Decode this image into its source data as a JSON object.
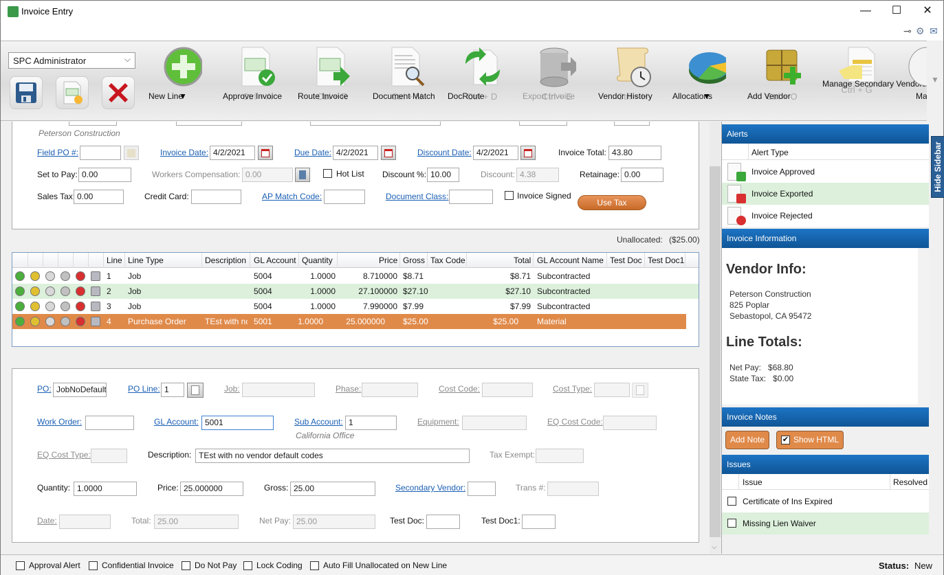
{
  "window": {
    "title": "Invoice Entry",
    "minimize": "—",
    "maximize": "☐",
    "close": "✕"
  },
  "ribbon": {
    "user_select": "SPC Administrator",
    "buttons": [
      {
        "label": "New Line",
        "shortcut": "",
        "dropdown": "▼",
        "icon": "plus-circle-icon",
        "enabled": true
      },
      {
        "label": "Approve Invoice",
        "shortcut": "Ctrl + A",
        "icon": "approve-invoice-icon",
        "enabled": true
      },
      {
        "label": "Route Invoice",
        "shortcut": "Ctrl + R",
        "icon": "route-invoice-icon",
        "enabled": true
      },
      {
        "label": "Document Match",
        "shortcut": "Ctrl + M",
        "icon": "document-match-icon",
        "enabled": true
      },
      {
        "label": "DocRoute",
        "shortcut": "Ctrl + D",
        "icon": "docroute-icon",
        "enabled": true
      },
      {
        "label": "Export Invoice",
        "shortcut": "Ctrl + E",
        "icon": "export-database-icon",
        "enabled": false
      },
      {
        "label": "Vendor History",
        "shortcut": "Ctrl + H",
        "icon": "vendor-history-icon",
        "enabled": true
      },
      {
        "label": "Allocations",
        "shortcut": "",
        "dropdown": "▼",
        "icon": "pie-chart-icon",
        "enabled": true
      },
      {
        "label": "Add Vendor",
        "shortcut": "Ctrl + O",
        "icon": "add-vendor-icon",
        "enabled": true
      },
      {
        "label": "Manage Secondary Vendors",
        "shortcut": "Ctrl + G",
        "icon": "secondary-vendors-icon",
        "enabled": true
      },
      {
        "label": "Match",
        "shortcut": "",
        "icon": "match-icon",
        "enabled": true
      }
    ]
  },
  "header_form": {
    "vendor_name": "Peterson Construction",
    "field_po_label": "Field PO #:",
    "field_po": "",
    "invoice_date_label": "Invoice Date:",
    "invoice_date": "4/2/2021",
    "due_date_label": "Due Date:",
    "due_date": "4/2/2021",
    "discount_date_label": "Discount Date:",
    "discount_date": "4/2/2021",
    "invoice_total_label": "Invoice Total:",
    "invoice_total": "43.80",
    "set_to_pay_label": "Set to Pay:",
    "set_to_pay": "0.00",
    "workers_comp_label": "Workers Compensation:",
    "workers_comp": "0.00",
    "hot_list_label": "Hot List",
    "discount_pct_label": "Discount %:",
    "discount_pct": "10.00",
    "discount_label": "Discount:",
    "discount": "4.38",
    "retainage_label": "Retainage:",
    "retainage": "0.00",
    "sales_tax_label": "Sales Tax:",
    "sales_tax": "0.00",
    "credit_card_label": "Credit Card:",
    "credit_card": "",
    "ap_match_label": "AP Match Code:",
    "ap_match": "",
    "doc_class_label": "Document Class:",
    "doc_class": "",
    "invoice_signed_label": "Invoice Signed",
    "use_tax_label": "Use Tax"
  },
  "unallocated": {
    "label": "Unallocated:",
    "value": "($25.00)"
  },
  "lines_grid": {
    "columns": [
      "Line",
      "Line Type",
      "Description",
      "GL Account",
      "Quantity",
      "Price",
      "Gross",
      "Tax Code",
      "Total",
      "GL Account Name",
      "Test Doc",
      "Test Doc1"
    ],
    "rows": [
      {
        "line": "1",
        "type": "Job",
        "desc": "",
        "gl": "5004",
        "qty": "1.0000",
        "price": "8.710000",
        "gross": "$8.71",
        "tax": "",
        "total": "$8.71",
        "glname": "Subcontracted"
      },
      {
        "line": "2",
        "type": "Job",
        "desc": "",
        "gl": "5004",
        "qty": "1.0000",
        "price": "27.100000",
        "gross": "$27.10",
        "tax": "",
        "total": "$27.10",
        "glname": "Subcontracted"
      },
      {
        "line": "3",
        "type": "Job",
        "desc": "",
        "gl": "5004",
        "qty": "1.0000",
        "price": "7.990000",
        "gross": "$7.99",
        "tax": "",
        "total": "$7.99",
        "glname": "Subcontracted"
      },
      {
        "line": "4",
        "type": "Purchase Order",
        "desc": "TEst with nc",
        "gl": "5001",
        "qty": "1.0000",
        "price": "25.000000",
        "gross": "$25.00",
        "tax": "",
        "total": "$25.00",
        "glname": "Material"
      }
    ]
  },
  "line_form": {
    "po_label": "PO:",
    "po": "JobNoDefault",
    "po_line_label": "PO Line:",
    "po_line": "1",
    "job_label": "Job:",
    "phase_label": "Phase:",
    "cost_code_label": "Cost Code:",
    "cost_type_label": "Cost Type:",
    "work_order_label": "Work Order:",
    "work_order": "",
    "gl_account_label": "GL Account:",
    "gl_account": "5001",
    "sub_account_label": "Sub Account:",
    "sub_account": "1",
    "sub_account_name": "California Office",
    "equipment_label": "Equipment:",
    "eq_cost_code_label": "EQ Cost Code:",
    "eq_cost_type_label": "EQ Cost Type:",
    "description_label": "Description:",
    "description": "TEst with no vendor default codes",
    "tax_exempt_label": "Tax Exempt:",
    "quantity_label": "Quantity:",
    "quantity": "1.0000",
    "price_label": "Price:",
    "price": "25.000000",
    "gross_label": "Gross:",
    "gross": "25.00",
    "secondary_vendor_label": "Secondary Vendor:",
    "trans_label": "Trans #:",
    "date_label": "Date:",
    "total_label": "Total:",
    "total": "25.00",
    "net_pay_label": "Net Pay:",
    "net_pay": "25.00",
    "test_doc_label": "Test Doc:",
    "test_doc1_label": "Test Doc1:"
  },
  "sidebar": {
    "hide_label": "Hide Sidebar",
    "alerts": {
      "title": "Alerts",
      "column": "Alert Type",
      "items": [
        "Invoice Approved",
        "Invoice Exported",
        "Invoice Rejected"
      ]
    },
    "info": {
      "title": "Invoice Information",
      "vendor_heading": "Vendor Info:",
      "vendor_name": "Peterson Construction",
      "address1": "825 Poplar",
      "address2": "Sebastopol, CA 95472",
      "totals_heading": "Line Totals:",
      "net_pay": "Net Pay:   $68.80",
      "state_tax": "State Tax:   $0.00"
    },
    "notes": {
      "title": "Invoice Notes",
      "add_note": "Add Note",
      "show_html": "Show HTML",
      "show_html_checked": true
    },
    "issues": {
      "title": "Issues",
      "col_issue": "Issue",
      "col_resolved": "Resolved",
      "items": [
        "Certificate of Ins Expired",
        "Missing Lien Waiver"
      ]
    }
  },
  "footer": {
    "checkboxes": [
      "Approval Alert",
      "Confidential Invoice",
      "Do Not Pay",
      "Lock Coding",
      "Auto Fill Unallocated on New Line"
    ],
    "status_label": "Status:",
    "status_value": "New"
  }
}
